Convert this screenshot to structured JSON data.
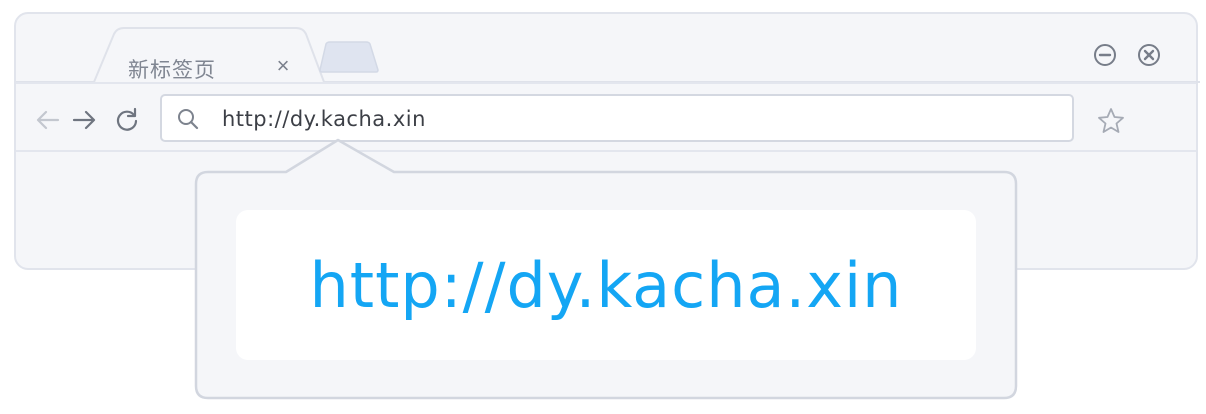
{
  "browser": {
    "tab": {
      "title": "新标签页",
      "close_label": "×"
    },
    "new_tab_icon": "new-tab-icon",
    "window_controls": {
      "minimize_icon": "minimize-circle-icon",
      "close_icon": "close-circle-icon"
    },
    "nav": {
      "back_icon": "arrow-left-icon",
      "forward_icon": "arrow-right-icon",
      "reload_icon": "reload-icon"
    },
    "address_bar": {
      "search_icon": "search-icon",
      "url": "http://dy.kacha.xin"
    },
    "bookmark_icon": "star-icon"
  },
  "callout": {
    "url": "http://dy.kacha.xin",
    "accent_color": "#14a6f4"
  },
  "colors": {
    "frame_border": "#e1e4ec",
    "frame_fill": "#f5f6f9",
    "icon_gray": "#7b818d"
  }
}
